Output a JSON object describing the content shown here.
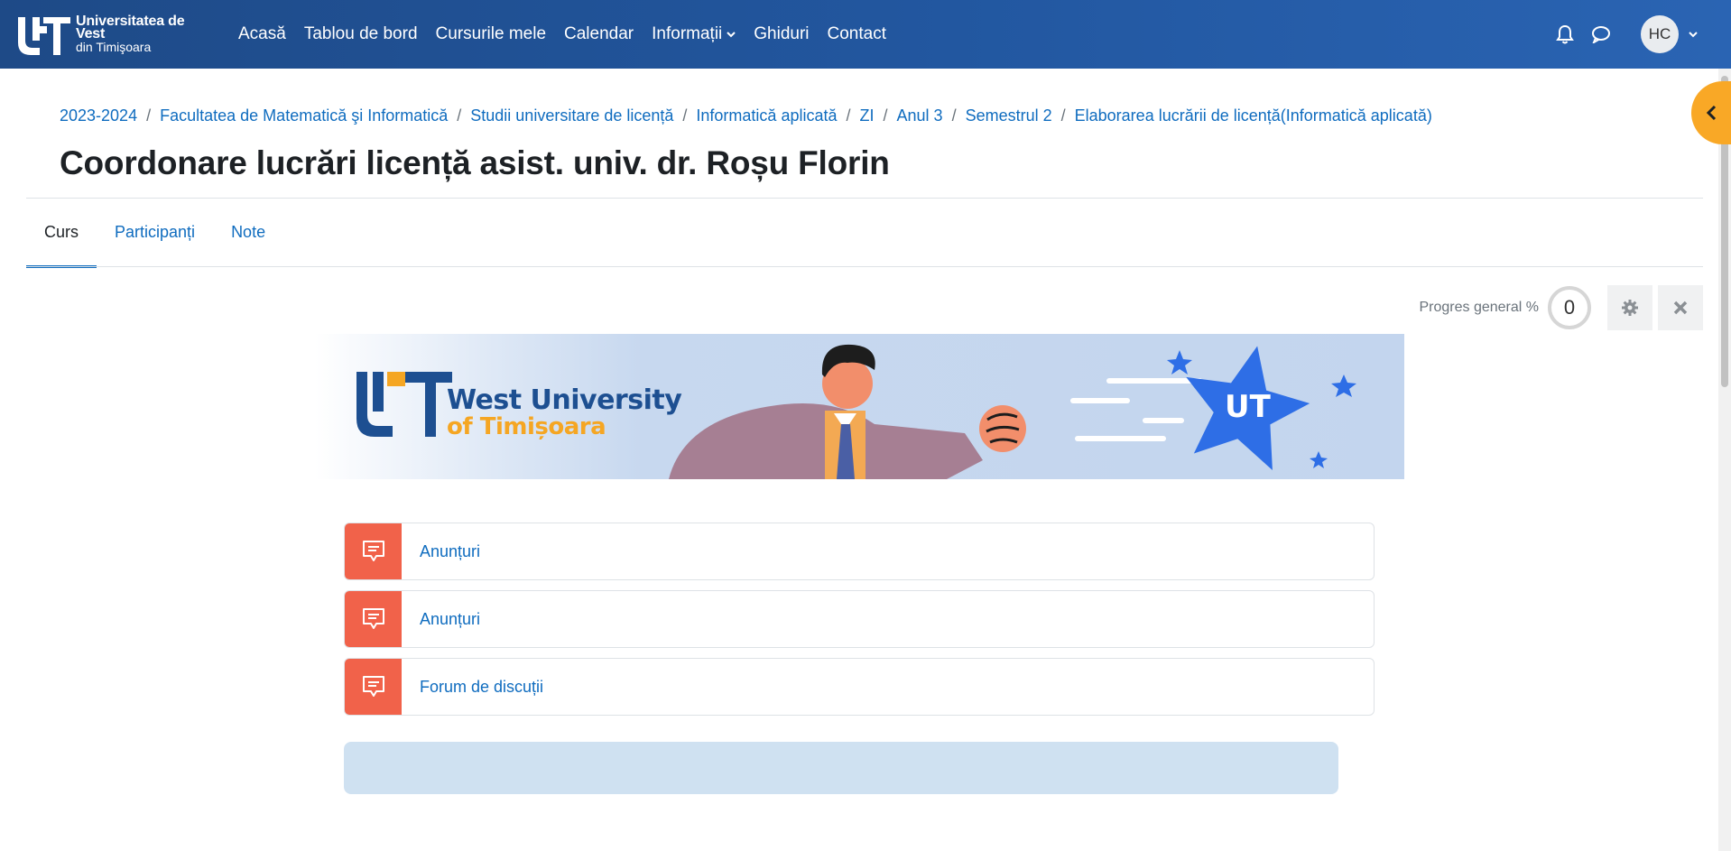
{
  "navbar": {
    "logo_line1": "Universitatea de Vest",
    "logo_line2": "din Timişoara",
    "links": [
      "Acasă",
      "Tablou de bord",
      "Cursurile mele",
      "Calendar",
      "Informații",
      "Ghiduri",
      "Contact"
    ],
    "user_initials": "HC"
  },
  "breadcrumb": [
    "2023-2024",
    "Facultatea de Matematică şi Informatică",
    "Studii universitare de licență",
    "Informatică aplicată",
    "ZI",
    "Anul 3",
    "Semestrul 2",
    "Elaborarea lucrării de licență(Informatică aplicată)"
  ],
  "breadcrumb_separator": "/",
  "page_title": "Coordonare lucrări licență asist. univ. dr. Roșu Florin",
  "tabs": [
    "Curs",
    "Participanți",
    "Note"
  ],
  "progress": {
    "label": "Progres general %",
    "value": "0"
  },
  "banner": {
    "title_line1": "West University",
    "title_line2": "of Timișoara"
  },
  "activities": [
    {
      "label": "Anunțuri",
      "icon": "forum-icon"
    },
    {
      "label": "Anunțuri",
      "icon": "forum-icon"
    },
    {
      "label": "Forum de discuții",
      "icon": "forum-icon"
    }
  ],
  "colors": {
    "navbar": "#2257a0",
    "link": "#0f6cbf",
    "activity_icon_bg": "#f1624a",
    "drawer_toggle": "#f9a826",
    "info_box": "#cfe1f1"
  }
}
